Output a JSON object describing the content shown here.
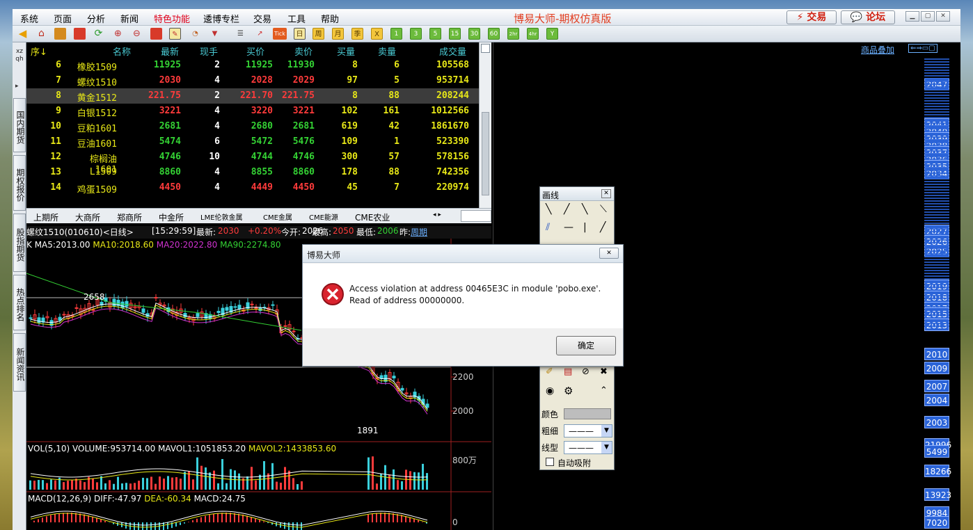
{
  "menu": {
    "items": [
      "系统",
      "页面",
      "分析",
      "新闻",
      "特色功能",
      "逶博专栏",
      "交易",
      "工具",
      "帮助"
    ],
    "app_title": "博易大师-期权仿真版",
    "trade_btn": "交易",
    "forum_btn": "论坛"
  },
  "toolbar": {
    "tick": "Tick",
    "period_buttons": [
      "日",
      "周",
      "月",
      "季",
      "X",
      "1",
      "3",
      "5",
      "15",
      "30",
      "60",
      "2hr",
      "4hr",
      "Y"
    ]
  },
  "side_tabs": [
    "xz qh",
    "国内期货",
    "期权报价",
    "股指期货",
    "热点排名",
    "新闻资讯"
  ],
  "quote_table": {
    "headers": [
      "序↓",
      "名称",
      "最新",
      "现手",
      "买价",
      "卖价",
      "买量",
      "卖量",
      "成交量"
    ],
    "rows": [
      {
        "no": "6",
        "name": "橡胶1509",
        "last": "11925",
        "vol": "2",
        "bid": "11925",
        "ask": "11930",
        "bidv": "8",
        "askv": "6",
        "total": "105568",
        "color": "gr"
      },
      {
        "no": "7",
        "name": "螺纹1510",
        "last": "2030",
        "vol": "4",
        "bid": "2028",
        "ask": "2029",
        "bidv": "97",
        "askv": "5",
        "total": "953714",
        "color": "rd"
      },
      {
        "no": "8",
        "name": "黄金1512",
        "last": "221.75",
        "vol": "2",
        "bid": "221.70",
        "ask": "221.75",
        "bidv": "8",
        "askv": "88",
        "total": "208244",
        "color": "rd"
      },
      {
        "no": "9",
        "name": "白银1512",
        "last": "3221",
        "vol": "4",
        "bid": "3220",
        "ask": "3221",
        "bidv": "102",
        "askv": "161",
        "total": "1012566",
        "color": "rd"
      },
      {
        "no": "10",
        "name": "豆粕1601",
        "last": "2681",
        "vol": "4",
        "bid": "2680",
        "ask": "2681",
        "bidv": "619",
        "askv": "42",
        "total": "1861670",
        "color": "gr"
      },
      {
        "no": "11",
        "name": "豆油1601",
        "last": "5474",
        "vol": "6",
        "bid": "5472",
        "ask": "5476",
        "bidv": "109",
        "askv": "1",
        "total": "523390",
        "color": "gr"
      },
      {
        "no": "12",
        "name": "棕榈油1601",
        "last": "4746",
        "vol": "10",
        "bid": "4744",
        "ask": "4746",
        "bidv": "300",
        "askv": "57",
        "total": "578156",
        "color": "gr"
      },
      {
        "no": "13",
        "name": "L1509",
        "last": "8860",
        "vol": "4",
        "bid": "8855",
        "ask": "8860",
        "bidv": "178",
        "askv": "88",
        "total": "742356",
        "color": "gr"
      },
      {
        "no": "14",
        "name": "鸡蛋1509",
        "last": "4450",
        "vol": "4",
        "bid": "4449",
        "ask": "4450",
        "bidv": "45",
        "askv": "7",
        "total": "220974",
        "color": "rd"
      }
    ]
  },
  "exchanges": [
    "上期所",
    "大商所",
    "郑商所",
    "中金所",
    "LME伦敦金属",
    "CME金属",
    "CME能源",
    "CME农业"
  ],
  "chart_info": {
    "symbol": "螺纹1510(010610)<日线>",
    "time": "[15:29:59]",
    "last_label": "最新:",
    "last": "2030",
    "change": "+0.20%",
    "open_label": "今开:",
    "open": "2026",
    "high_label": "最高:",
    "high": "2050",
    "low_label": "最低:",
    "low": "2006",
    "prev_label": "昨:",
    "period": "周期"
  },
  "ma_line": {
    "k": "K",
    "ma5": "MA5:2013.00",
    "ma10": "MA10:2018.60",
    "ma20": "MA20:2022.80",
    "ma90": "MA90:2274.80"
  },
  "chart_labels": {
    "high_mark": "2658",
    "low_mark": "1891",
    "axis_2200": "2200",
    "axis_2000": "2000",
    "vol_axis": "800万",
    "macd_axis": "0"
  },
  "vol_line": {
    "label": "VOL(5,10) VOLUME:953714.00",
    "mavol1": "MAVOL1:1051853.20",
    "mavol2": "MAVOL2:1433853.60"
  },
  "macd_line": {
    "label": "MACD(12,26,9)",
    "diff": "DIFF:-47.97",
    "dea": "DEA:-60.34",
    "macd": "MACD:24.75"
  },
  "right_panel": {
    "overlay_link": "商品叠加"
  },
  "price_tags": [
    "2047",
    "2041",
    "2040",
    "2039",
    "2038",
    "2037",
    "2036",
    "2035",
    "2034",
    "2027",
    "2026",
    "2025",
    "2019",
    "2018",
    "2017",
    "2015",
    "2013",
    "2010",
    "2009",
    "2007",
    "2004",
    "2003",
    "21996",
    "18266",
    "13923",
    "9984",
    "7020",
    "5499"
  ],
  "draw_toolbar": {
    "title": "画线",
    "color_label": "颜色",
    "weight_label": "粗细",
    "style_label": "线型",
    "auto_snap": "自动吸附"
  },
  "dialog": {
    "title": "博易大师",
    "message_line1": "Access violation at address 00465E3C in module 'pobo.exe'.",
    "message_line2": "Read of address 00000000.",
    "ok": "确定"
  },
  "colors": {
    "up": "#ff3b3b",
    "down": "#34d234",
    "accent": "#e23c1e",
    "volume": "#3ad0dc"
  }
}
